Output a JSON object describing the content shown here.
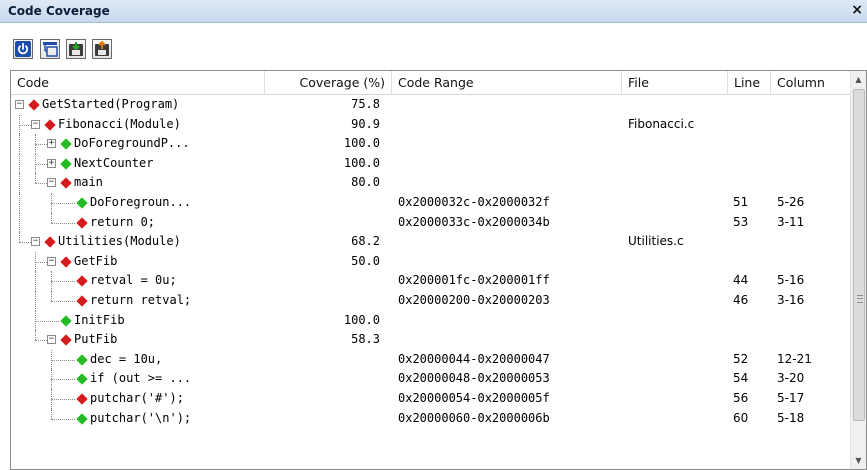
{
  "window": {
    "title": "Code Coverage",
    "close_glyph": "×"
  },
  "toolbar": {
    "buttons": [
      {
        "icon": "power-icon"
      },
      {
        "icon": "collapse-tree-icon"
      },
      {
        "icon": "import-coverage-icon"
      },
      {
        "icon": "export-coverage-icon"
      }
    ]
  },
  "columns": {
    "code": "Code",
    "coverage": "Coverage (%)",
    "range": "Code Range",
    "file": "File",
    "line": "Line",
    "column": "Column"
  },
  "colors": {
    "covered": "#22bb22",
    "uncovered": "#d41c1c",
    "accent": "#1f4ea8"
  },
  "rows": [
    {
      "depth": 0,
      "expander": "minus",
      "status": "uncovered",
      "code": "GetStarted(Program)",
      "coverage": "75.8",
      "range": "",
      "file": "",
      "line": "",
      "column": ""
    },
    {
      "depth": 1,
      "expander": "minus",
      "status": "uncovered",
      "code": "Fibonacci(Module)",
      "coverage": "90.9",
      "range": "",
      "file": "Fibonacci.c",
      "line": "",
      "column": ""
    },
    {
      "depth": 2,
      "expander": "plus",
      "status": "covered",
      "code": "DoForegroundP...",
      "coverage": "100.0",
      "range": "",
      "file": "",
      "line": "",
      "column": ""
    },
    {
      "depth": 2,
      "expander": "plus",
      "status": "covered",
      "code": "NextCounter",
      "coverage": "100.0",
      "range": "",
      "file": "",
      "line": "",
      "column": ""
    },
    {
      "depth": 2,
      "expander": "minus",
      "status": "uncovered",
      "code": "main",
      "coverage": "80.0",
      "range": "",
      "file": "",
      "line": "",
      "column": ""
    },
    {
      "depth": 3,
      "expander": "none",
      "status": "covered",
      "code": "DoForegroun...",
      "coverage": "",
      "range": "0x2000032c-0x2000032f",
      "file": "",
      "line": "51",
      "column": "5-26"
    },
    {
      "depth": 3,
      "expander": "none",
      "status": "uncovered",
      "code": "return 0;",
      "coverage": "",
      "range": "0x2000033c-0x2000034b",
      "file": "",
      "line": "53",
      "column": "3-11"
    },
    {
      "depth": 1,
      "expander": "minus",
      "status": "uncovered",
      "code": "Utilities(Module)",
      "coverage": "68.2",
      "range": "",
      "file": "Utilities.c",
      "line": "",
      "column": ""
    },
    {
      "depth": 2,
      "expander": "minus",
      "status": "uncovered",
      "code": "GetFib",
      "coverage": "50.0",
      "range": "",
      "file": "",
      "line": "",
      "column": ""
    },
    {
      "depth": 3,
      "expander": "none",
      "status": "uncovered",
      "code": "retval = 0u;",
      "coverage": "",
      "range": "0x200001fc-0x200001ff",
      "file": "",
      "line": "44",
      "column": "5-16"
    },
    {
      "depth": 3,
      "expander": "none",
      "status": "uncovered",
      "code": "return retval;",
      "coverage": "",
      "range": "0x20000200-0x20000203",
      "file": "",
      "line": "46",
      "column": "3-16"
    },
    {
      "depth": 2,
      "expander": "none",
      "status": "covered",
      "code": "InitFib",
      "coverage": "100.0",
      "range": "",
      "file": "",
      "line": "",
      "column": ""
    },
    {
      "depth": 2,
      "expander": "minus",
      "status": "uncovered",
      "code": "PutFib",
      "coverage": "58.3",
      "range": "",
      "file": "",
      "line": "",
      "column": ""
    },
    {
      "depth": 3,
      "expander": "none",
      "status": "covered",
      "code": "dec = 10u,",
      "coverage": "",
      "range": "0x20000044-0x20000047",
      "file": "",
      "line": "52",
      "column": "12-21"
    },
    {
      "depth": 3,
      "expander": "none",
      "status": "covered",
      "code": "if (out >= ...",
      "coverage": "",
      "range": "0x20000048-0x20000053",
      "file": "",
      "line": "54",
      "column": "3-20"
    },
    {
      "depth": 3,
      "expander": "none",
      "status": "uncovered",
      "code": "putchar('#');",
      "coverage": "",
      "range": "0x20000054-0x2000005f",
      "file": "",
      "line": "56",
      "column": "5-17"
    },
    {
      "depth": 3,
      "expander": "none",
      "status": "covered",
      "code": "putchar('\\n');",
      "coverage": "",
      "range": "0x20000060-0x2000006b",
      "file": "",
      "line": "60",
      "column": "5-18"
    }
  ]
}
